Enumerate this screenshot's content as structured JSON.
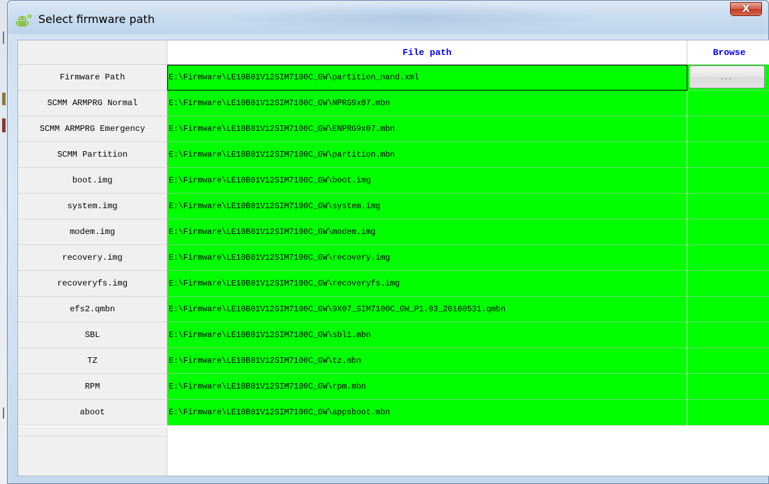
{
  "window": {
    "title": "Select firmware path",
    "close_label": "X"
  },
  "table": {
    "columns": {
      "path": "File path",
      "browse": "Browse"
    },
    "browse_button_label": "...",
    "rows": [
      {
        "label": "Firmware Path",
        "path": "E:\\Firmware\\LE10B01V12SIM7100C_GW\\partition_nand.xml"
      },
      {
        "label": "SCMM ARMPRG Normal",
        "path": "E:\\Firmware\\LE10B01V12SIM7100C_GW\\NPRG9x07.mbn"
      },
      {
        "label": "SCMM ARMPRG Emergency",
        "path": "E:\\Firmware\\LE10B01V12SIM7100C_GW\\ENPRG9x07.mbn"
      },
      {
        "label": "SCMM Partition",
        "path": "E:\\Firmware\\LE10B01V12SIM7100C_GW\\partition.mbn"
      },
      {
        "label": "boot.img",
        "path": "E:\\Firmware\\LE10B01V12SIM7100C_GW\\boot.img"
      },
      {
        "label": "system.img",
        "path": "E:\\Firmware\\LE10B01V12SIM7100C_GW\\system.img"
      },
      {
        "label": "modem.img",
        "path": "E:\\Firmware\\LE10B01V12SIM7100C_GW\\modem.img"
      },
      {
        "label": "recovery.img",
        "path": "E:\\Firmware\\LE10B01V12SIM7100C_GW\\recovery.img"
      },
      {
        "label": "recoveryfs.img",
        "path": "E:\\Firmware\\LE10B01V12SIM7100C_GW\\recoveryfs.img"
      },
      {
        "label": "efs2.qmbn",
        "path": "E:\\Firmware\\LE10B01V12SIM7100C_GW\\9X07_SIM7100C_GW_P1.03_20160531.qmbn"
      },
      {
        "label": "SBL",
        "path": "E:\\Firmware\\LE10B01V12SIM7100C_GW\\sbl1.mbn"
      },
      {
        "label": "TZ",
        "path": "E:\\Firmware\\LE10B01V12SIM7100C_GW\\tz.mbn"
      },
      {
        "label": "RPM",
        "path": "E:\\Firmware\\LE10B01V12SIM7100C_GW\\rpm.mbn"
      },
      {
        "label": "aboot",
        "path": "E:\\Firmware\\LE10B01V12SIM7100C_GW\\appsboot.mbn"
      }
    ]
  },
  "colors": {
    "path_cell_bg": "#00ff00",
    "header_text": "#0000ee",
    "close_button": "#c23a22"
  },
  "icons": {
    "app_icon": "android-icon"
  }
}
